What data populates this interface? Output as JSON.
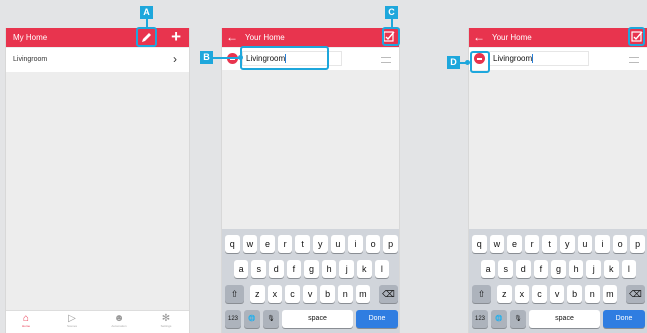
{
  "screen1": {
    "title": "My Home",
    "add_symbol": "+",
    "room": "Livingroom",
    "chevron": "›",
    "tabs": [
      {
        "label": "Home",
        "icon": "house-icon"
      },
      {
        "label": "Scenes",
        "icon": "play-icon"
      },
      {
        "label": "Automation",
        "icon": "robot-icon"
      },
      {
        "label": "Settings",
        "icon": "gear-icon"
      }
    ]
  },
  "screen2": {
    "title": "Your Home",
    "back_symbol": "←",
    "room_value": "Livingroom"
  },
  "screen3": {
    "title": "Your Home",
    "back_symbol": "←",
    "room_value": "Livingroom"
  },
  "keyboard": {
    "row1": [
      "q",
      "w",
      "e",
      "r",
      "t",
      "y",
      "u",
      "i",
      "o",
      "p"
    ],
    "row2": [
      "a",
      "s",
      "d",
      "f",
      "g",
      "h",
      "j",
      "k",
      "l"
    ],
    "row3": [
      "z",
      "x",
      "c",
      "v",
      "b",
      "n",
      "m"
    ],
    "shift_symbol": "⇧",
    "delete_symbol": "⌫",
    "numbers_label": "123",
    "globe_symbol": "🌐",
    "mic_symbol": "🎙",
    "space_label": "space",
    "done_label": "Done"
  },
  "markers": {
    "a": "A",
    "b": "B",
    "c": "C",
    "d": "D"
  },
  "colors": {
    "accent": "#e8344e",
    "callout": "#1ea7dc",
    "done_key": "#2f7de1"
  }
}
